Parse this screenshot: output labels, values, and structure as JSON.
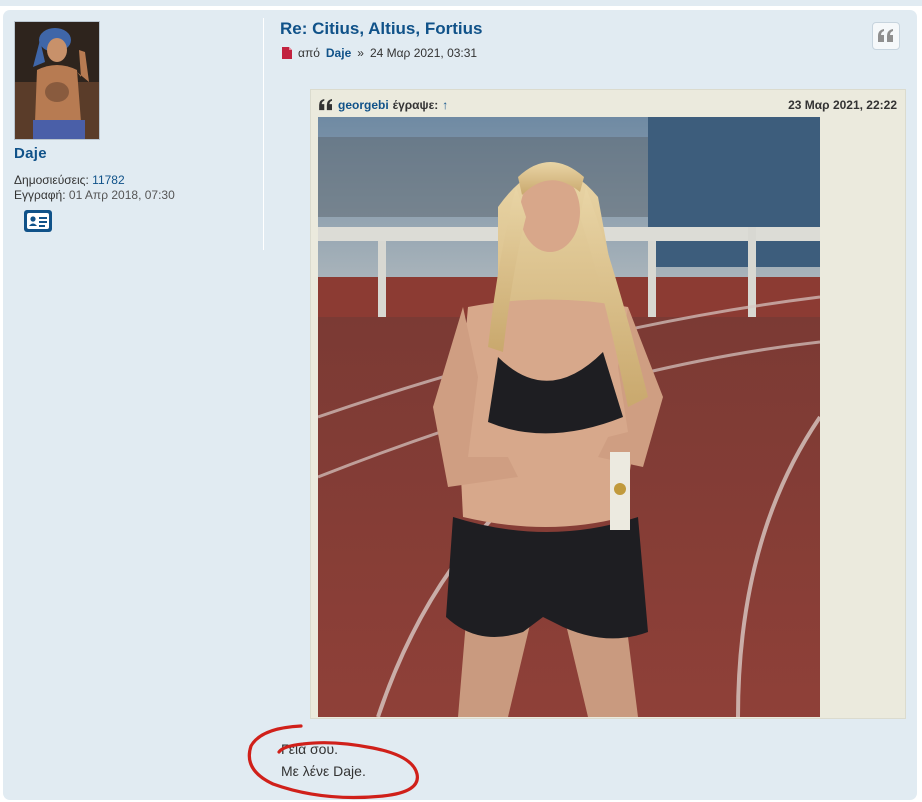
{
  "profile": {
    "username": "Daje",
    "posts_label": "Δημοσιεύσεις:",
    "posts_value": "11782",
    "joined_label": "Εγγραφή:",
    "joined_value": "01 Απρ 2018, 07:30",
    "contact_icon": "contact-card-icon"
  },
  "post": {
    "title": "Re: Citius, Altius, Fortius",
    "by_label": "από",
    "author": "Daje",
    "separator": "»",
    "date": "24 Μαρ 2021, 03:31",
    "quote_button_icon": "quote-icon"
  },
  "quote": {
    "icon": "quote-marks-icon",
    "cited_user": "georgebi",
    "wrote_label": "έγραψε:",
    "jump_arrow": "↑",
    "date": "23 Μαρ 2021, 22:22",
    "image_icon": "quoted-photo"
  },
  "reply": {
    "line1": "Γεια σου.",
    "line2": "Με λένε Daje."
  },
  "colors": {
    "post_bg": "#e1ebf2",
    "link": "#105289",
    "quote_bg": "#ebeadd",
    "annotation": "#d0201a"
  }
}
